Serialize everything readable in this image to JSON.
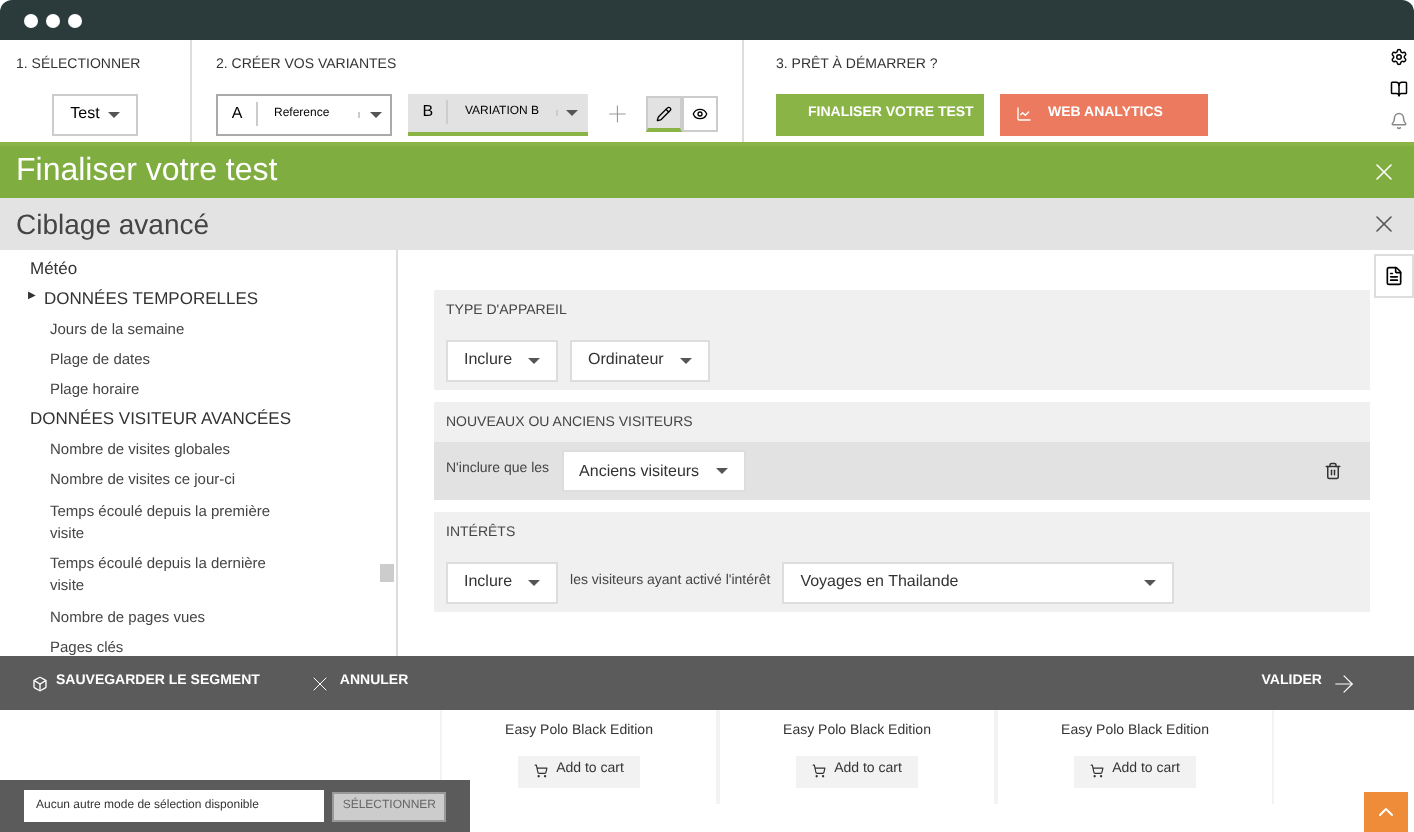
{
  "steps": [
    {
      "label": "1. SÉLECTIONNER"
    },
    {
      "label": "2. CRÉER VOS VARIANTES"
    },
    {
      "label": "3. PRÊT À DÉMARRER ?"
    }
  ],
  "test_select": {
    "value": "Test"
  },
  "variants": [
    {
      "badge": "A",
      "value": "Reference",
      "selected": false
    },
    {
      "badge": "B",
      "value": "VARIATION B",
      "selected": true
    }
  ],
  "modes": [
    {
      "kind": "edit",
      "selected": true
    },
    {
      "kind": "preview",
      "selected": false
    }
  ],
  "actions": [
    {
      "label": "FINALISER VOTRE TEST",
      "kind": "finalize"
    },
    {
      "label": "WEB ANALYTICS",
      "kind": "analytics"
    }
  ],
  "dialog": {
    "title": "Finaliser votre test"
  },
  "panel": {
    "title": "Ciblage avancé"
  },
  "sidebar": {
    "items": [
      {
        "label": "Météo"
      },
      {
        "label": "DONNÉES TEMPORELLES",
        "marker": "▶",
        "children": [
          {
            "label": "Jours de la semaine"
          },
          {
            "label": "Plage de dates"
          },
          {
            "label": "Plage horaire"
          }
        ]
      },
      {
        "label": "DONNÉES VISITEUR AVANCÉES",
        "children": [
          {
            "label": "Nombre de visites globales"
          },
          {
            "label": "Nombre de visites ce jour-ci"
          },
          {
            "label": "Temps écoulé depuis la première visite"
          },
          {
            "label": "Temps écoulé depuis la dernière visite"
          },
          {
            "label": "Nombre de pages vues"
          },
          {
            "label": "Pages clés"
          }
        ]
      }
    ]
  },
  "filters": [
    {
      "title": "TYPE D'APPAREIL",
      "highlighted": false,
      "deletable": false,
      "items": [
        {
          "kind": "dropdown",
          "value": "Inclure"
        },
        {
          "kind": "dropdown",
          "value": "Ordinateur"
        }
      ]
    },
    {
      "title": "NOUVEAUX OU ANCIENS VISITEURS",
      "highlighted": true,
      "deletable": true,
      "items": [
        {
          "kind": "text",
          "text": "N'inclure que les"
        },
        {
          "kind": "dropdown",
          "value": "Anciens visiteurs"
        }
      ]
    },
    {
      "title": "INTÉRÊTS",
      "highlighted": false,
      "deletable": false,
      "items": [
        {
          "kind": "dropdown",
          "value": "Inclure"
        },
        {
          "kind": "text",
          "text": "les visiteurs ayant activé l'intérêt"
        },
        {
          "kind": "wide-dropdown",
          "value": "Voyages en Thailande"
        }
      ]
    }
  ],
  "footer": {
    "save": "SAUVEGARDER LE SEGMENT",
    "cancel": "ANNULER",
    "validate": "VALIDER"
  },
  "products": [
    {
      "name": "Easy Polo Black Edition",
      "button": "Add to cart"
    },
    {
      "name": "Easy Polo Black Edition",
      "button": "Add to cart"
    },
    {
      "name": "Easy Polo Black Edition",
      "button": "Add to cart"
    }
  ],
  "selection_bar": {
    "value": "Aucun autre mode de sélection disponible",
    "button": "SÉLECTIONNER"
  }
}
